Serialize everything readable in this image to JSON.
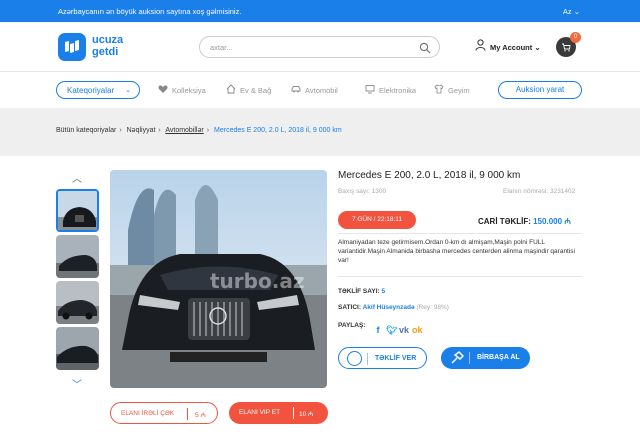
{
  "topbar": {
    "welcome": "Azərbaycanın ən böyük auksion saytına xoş gəlmisiniz.",
    "lang": "Az"
  },
  "header": {
    "logo_line1": "ucuza",
    "logo_line2": "getdi",
    "search_placeholder": "axtar...",
    "account_label": "My Account",
    "cart_count": "0"
  },
  "nav": {
    "categories_label": "Kateqoriyalar",
    "items": [
      {
        "label": "Kolleksiya",
        "icon": "heart-icon"
      },
      {
        "label": "Ev & Bağ",
        "icon": "house-icon"
      },
      {
        "label": "Avtomobil",
        "icon": "car-icon"
      },
      {
        "label": "Elektronika",
        "icon": "monitor-icon"
      },
      {
        "label": "Geyim",
        "icon": "shirt-icon"
      }
    ],
    "create_label": "Auksion yarat"
  },
  "breadcrumb": [
    "Bütün kateqoriyalar",
    "Nəqliyyat",
    "Avtomobillər",
    "Mercedes E 200, 2.0 L, 2018 il, 9 000 km"
  ],
  "product": {
    "title": "Mercedes E 200, 2.0 L, 2018 il, 9 000 km",
    "views": "Baxış sayı: 1300",
    "listing_no": "Elanın nömrəsi: 3231402",
    "timer": "7 GÜN / 22:18:11",
    "current_bid_label": "CARİ TƏKLİF:",
    "current_bid_value": "150.000",
    "description": "Almaniyadan teze getirmisem.Ordan 0-km dı almişam,Maşin polni FULL variantidir.Maşin Almanida birbasha mercedes centerden alinma maşindir qarantisi var!",
    "offers_label": "TƏKLİF SAYI:",
    "offers_value": "5",
    "seller_label": "SATICI:",
    "seller_name": "Akif Hüseynzadə",
    "seller_rating": "(Rey: 98%)",
    "share_label": "PAYLAŞ:",
    "offer_button": "TƏKLİF VER",
    "buy_button": "BİRBAŞA AL",
    "promo_up_label": "ELANI İRƏLİ ÇƏK",
    "promo_up_price": "5",
    "promo_vip_label": "ELANI VIP ET",
    "promo_vip_price": "10",
    "watermark": "turbo.az"
  },
  "colors": {
    "accent": "#1a7fe8",
    "danger": "#f2533f",
    "band": "#efefef"
  }
}
